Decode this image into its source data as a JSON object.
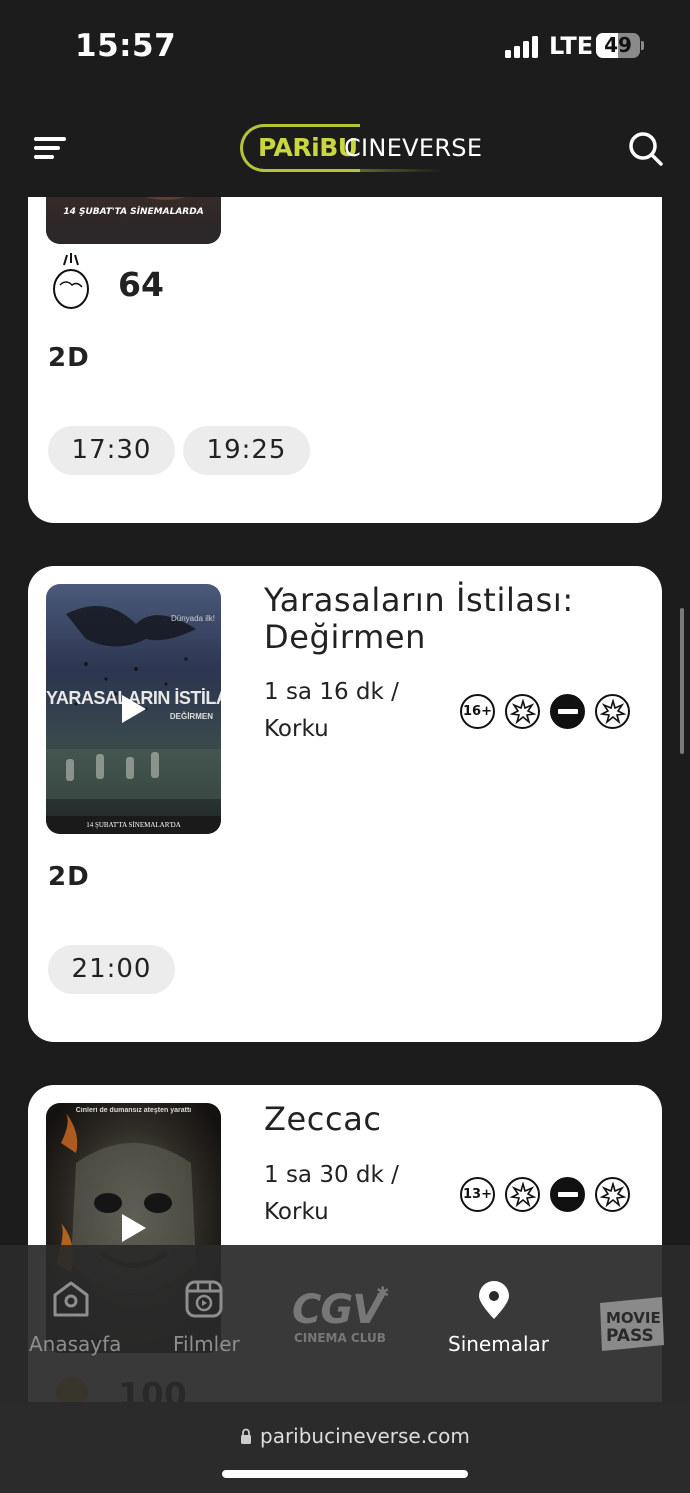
{
  "status_bar": {
    "time": "15:57",
    "network": "LTE",
    "battery": "49",
    "battery_level": 0.49
  },
  "header": {
    "logo_part1": "PARiBU",
    "logo_part2": "CINEVERSE",
    "menu_icon": "hamburger-menu-icon",
    "search_icon": "search-icon",
    "accent_color": "#b5c435"
  },
  "movies": [
    {
      "poster_caption": "14 ŞUBAT'TA SİNEMALARDA",
      "score": "64",
      "score_icon": "popcorn-egg-icon",
      "format": "2D",
      "showtimes": [
        "17:30",
        "19:25"
      ]
    },
    {
      "title_line1": "Yarasaların İstilası:",
      "title_line2": "Değirmen",
      "duration": "1 sa 16 dk /",
      "genre": "Korku",
      "age_rating": "16+",
      "poster_title": "YARASALARIN İSTİLASI",
      "poster_subtitle": "DEĞİRMEN",
      "poster_tag": "Dünyada ilk!",
      "poster_caption": "14 ŞUBAT'TA SİNEMALAR'DA",
      "format": "2D",
      "showtimes": [
        "21:00"
      ]
    },
    {
      "title_line1": "Zeccac",
      "duration": "1 sa 30 dk /",
      "genre": "Korku",
      "age_rating": "13+",
      "poster_tagline": "Cinleri de dumansız ateşten yarattı",
      "score": "100"
    }
  ],
  "bottom_nav": {
    "items": [
      {
        "label": "Anasayfa",
        "icon": "home-icon"
      },
      {
        "label": "Filmler",
        "icon": "film-icon"
      },
      {
        "label": "CGV",
        "sublabel": "CINEMA CLUB",
        "icon": "cgv-logo"
      },
      {
        "label": "Sinemalar",
        "icon": "location-pin-icon"
      },
      {
        "label": "CGV MOVIE PASS",
        "icon": "moviepass-logo"
      }
    ],
    "active": "Sinemalar"
  },
  "browser": {
    "url": "paribucineverse.com"
  }
}
